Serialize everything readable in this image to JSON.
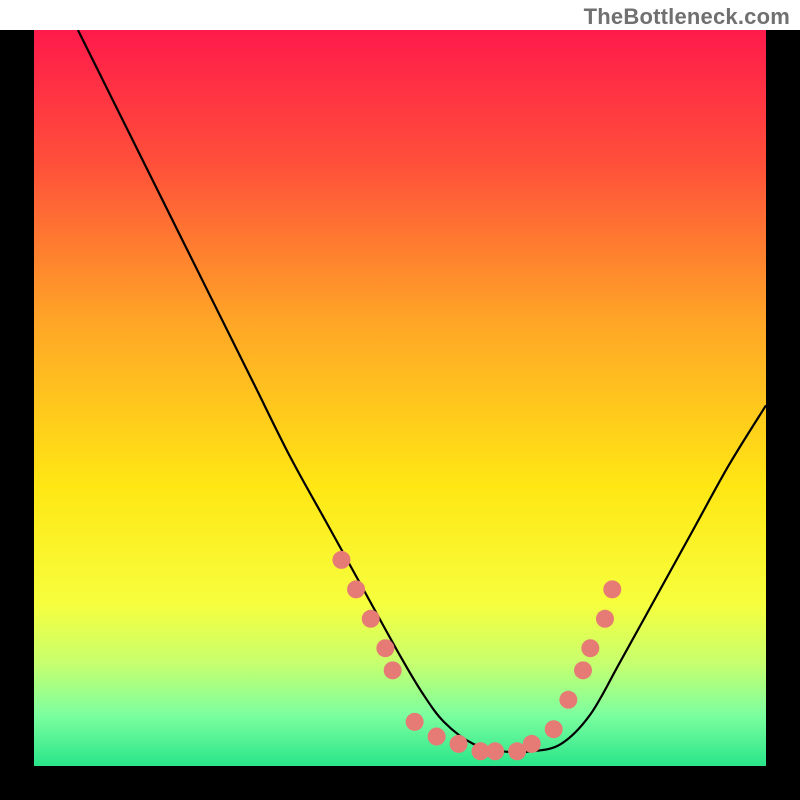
{
  "watermark": "TheBottleneck.com",
  "chart_data": {
    "type": "line",
    "title": "",
    "xlabel": "",
    "ylabel": "",
    "xlim": [
      0,
      100
    ],
    "ylim": [
      0,
      100
    ],
    "background_gradient": {
      "stops": [
        {
          "t": 0.0,
          "color": "#ff1a4b"
        },
        {
          "t": 0.18,
          "color": "#ff4f3a"
        },
        {
          "t": 0.4,
          "color": "#ffa726"
        },
        {
          "t": 0.62,
          "color": "#ffe714"
        },
        {
          "t": 0.78,
          "color": "#f6ff3e"
        },
        {
          "t": 0.86,
          "color": "#c7ff6e"
        },
        {
          "t": 0.93,
          "color": "#7dff9f"
        },
        {
          "t": 1.0,
          "color": "#29e58a"
        }
      ]
    },
    "series": [
      {
        "name": "bottleneck-curve",
        "color": "#000000",
        "x": [
          6,
          10,
          15,
          20,
          25,
          30,
          35,
          40,
          45,
          50,
          53,
          56,
          60,
          64,
          68,
          72,
          76,
          80,
          85,
          90,
          95,
          100
        ],
        "values": [
          100,
          92,
          82,
          72,
          62,
          52,
          42,
          33,
          24,
          15,
          10,
          6,
          3,
          2,
          2,
          3,
          7,
          14,
          23,
          32,
          41,
          49
        ]
      }
    ],
    "markers": {
      "name": "highlight-points",
      "color": "#e67b76",
      "radius": 9,
      "points": [
        {
          "x": 42,
          "y": 28
        },
        {
          "x": 44,
          "y": 24
        },
        {
          "x": 46,
          "y": 20
        },
        {
          "x": 48,
          "y": 16
        },
        {
          "x": 49,
          "y": 13
        },
        {
          "x": 52,
          "y": 6
        },
        {
          "x": 55,
          "y": 4
        },
        {
          "x": 58,
          "y": 3
        },
        {
          "x": 61,
          "y": 2
        },
        {
          "x": 63,
          "y": 2
        },
        {
          "x": 66,
          "y": 2
        },
        {
          "x": 68,
          "y": 3
        },
        {
          "x": 71,
          "y": 5
        },
        {
          "x": 73,
          "y": 9
        },
        {
          "x": 75,
          "y": 13
        },
        {
          "x": 76,
          "y": 16
        },
        {
          "x": 78,
          "y": 20
        },
        {
          "x": 79,
          "y": 24
        }
      ]
    },
    "border_color": "#000000",
    "border_width": 34
  }
}
